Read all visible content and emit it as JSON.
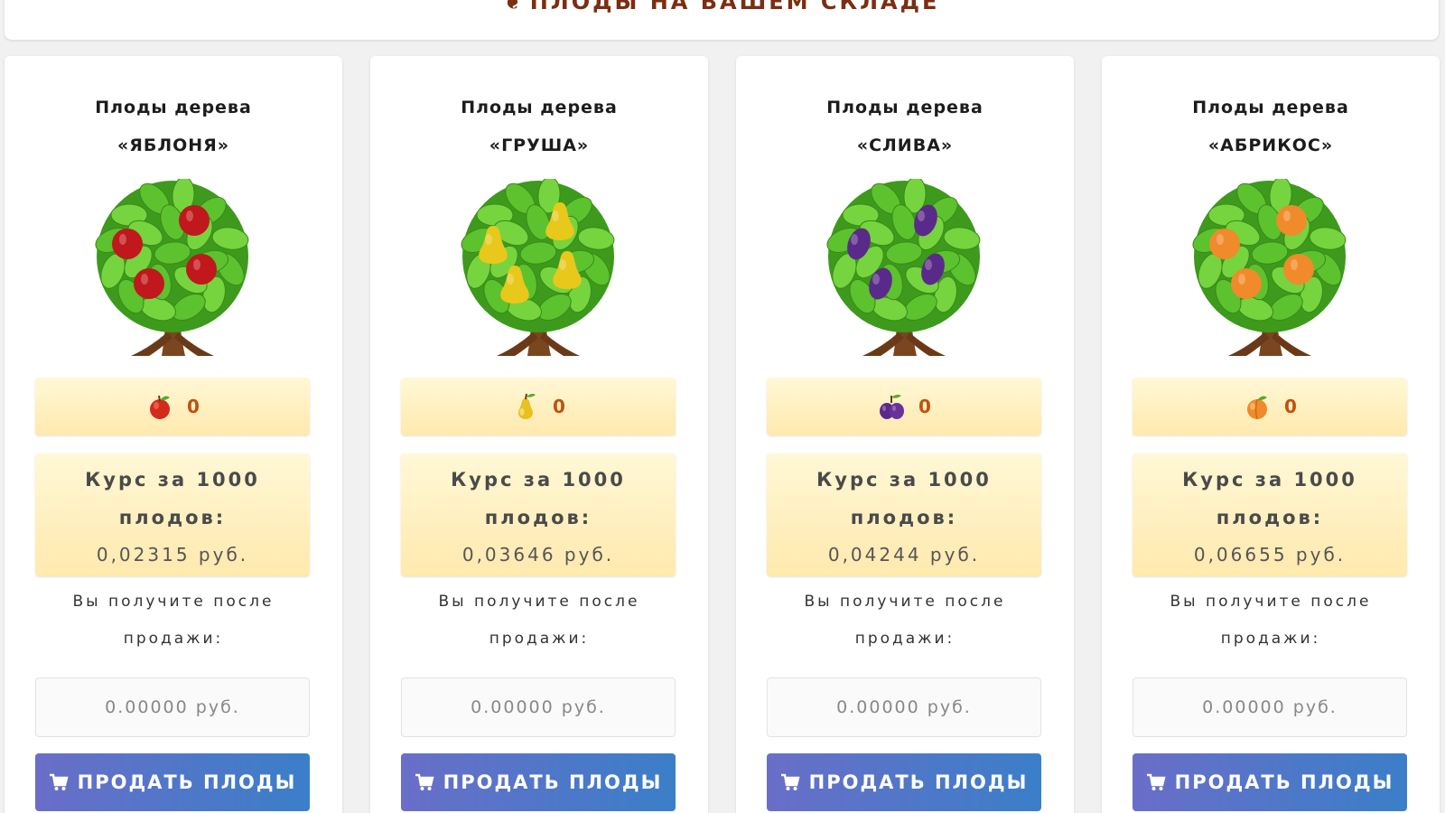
{
  "header": {
    "title": "ПЛОДЫ НА ВАШЕМ СКЛАДЕ"
  },
  "colors": {
    "title": "#7a2e12",
    "count": "#c0520e",
    "button": "#5a74c8",
    "leaf": "#4caf2a"
  },
  "cards": [
    {
      "title_line1": "Плоды дерева",
      "title_line2": "«ЯБЛОНЯ»",
      "tree_icon": "apple-tree-icon",
      "fruit_icon": "apple-icon",
      "fruit_color": "#c0181c",
      "count": "0",
      "rate_label_line1": "Курс за 1000",
      "rate_label_line2": "плодов:",
      "rate_value": "0,02315 руб.",
      "receive_line1": "Вы получите после",
      "receive_line2": "продажи:",
      "receive_value": "0.00000 руб.",
      "sell_label": "ПРОДАТЬ ПЛОДЫ"
    },
    {
      "title_line1": "Плоды дерева",
      "title_line2": "«ГРУША»",
      "tree_icon": "pear-tree-icon",
      "fruit_icon": "pear-icon",
      "fruit_color": "#e8c81a",
      "count": "0",
      "rate_label_line1": "Курс за 1000",
      "rate_label_line2": "плодов:",
      "rate_value": "0,03646 руб.",
      "receive_line1": "Вы получите после",
      "receive_line2": "продажи:",
      "receive_value": "0.00000 руб.",
      "sell_label": "ПРОДАТЬ ПЛОДЫ"
    },
    {
      "title_line1": "Плоды дерева",
      "title_line2": "«СЛИВА»",
      "tree_icon": "plum-tree-icon",
      "fruit_icon": "plum-icon",
      "fruit_color": "#5a2a8a",
      "count": "0",
      "rate_label_line1": "Курс за 1000",
      "rate_label_line2": "плодов:",
      "rate_value": "0,04244 руб.",
      "receive_line1": "Вы получите после",
      "receive_line2": "продажи:",
      "receive_value": "0.00000 руб.",
      "sell_label": "ПРОДАТЬ ПЛОДЫ"
    },
    {
      "title_line1": "Плоды дерева",
      "title_line2": "«АБРИКОС»",
      "tree_icon": "apricot-tree-icon",
      "fruit_icon": "apricot-icon",
      "fruit_color": "#f08a2a",
      "count": "0",
      "rate_label_line1": "Курс за 1000",
      "rate_label_line2": "плодов:",
      "rate_value": "0,06655 руб.",
      "receive_line1": "Вы получите после",
      "receive_line2": "продажи:",
      "receive_value": "0.00000 руб.",
      "sell_label": "ПРОДАТЬ ПЛОДЫ"
    }
  ]
}
